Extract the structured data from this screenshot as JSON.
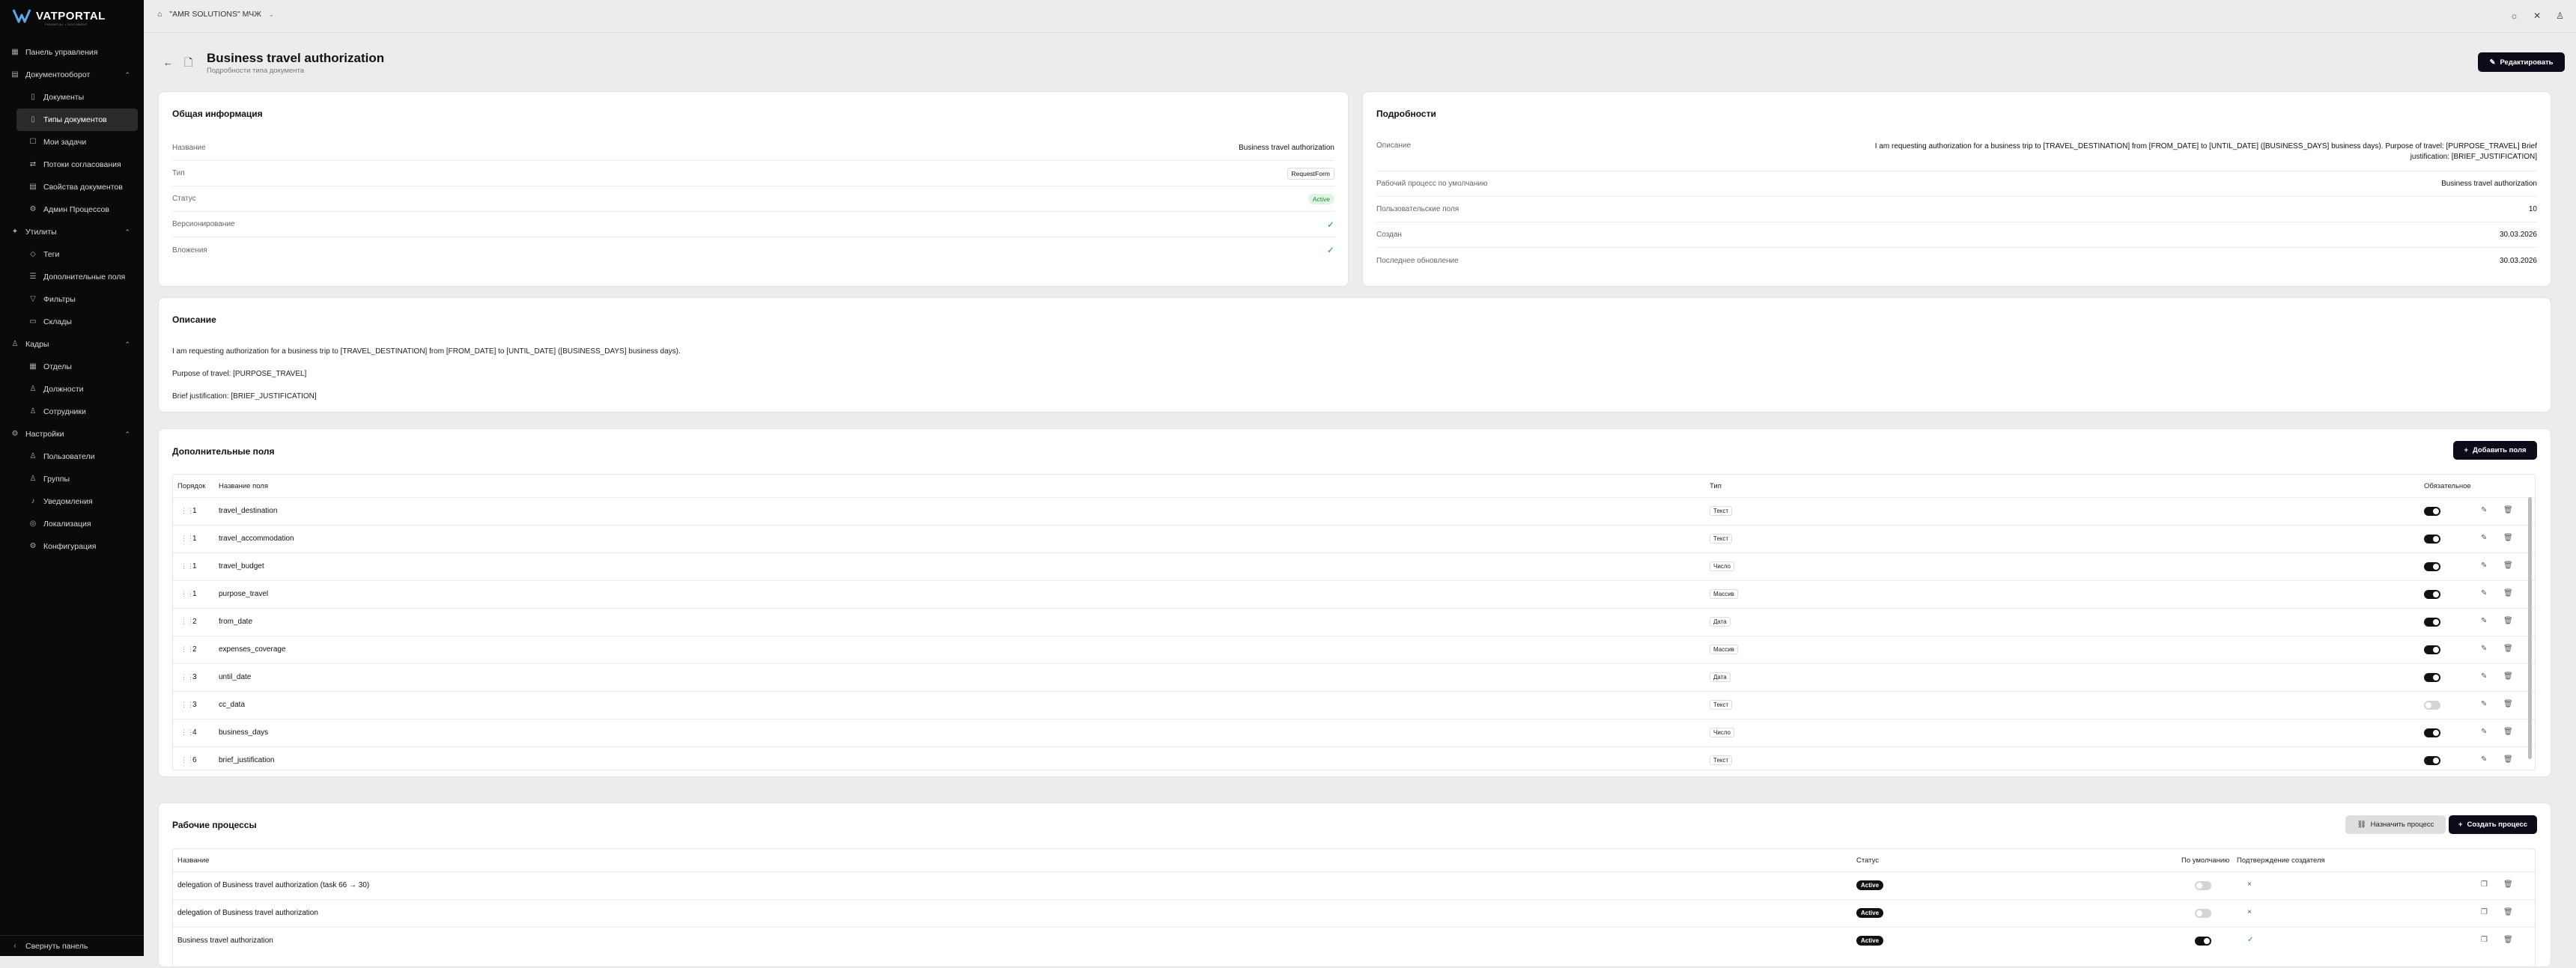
{
  "brand": {
    "name": "VATPORTAL",
    "tagline": "FINANCIAL • DOCUMENT"
  },
  "topbar": {
    "org": "\"AMR SOLUTIONS\" МЧЖ"
  },
  "sidebar": {
    "items": [
      {
        "label": "Панель управления",
        "icon": "grid-icon",
        "level": "top"
      },
      {
        "label": "Документооборот",
        "icon": "doc-icon",
        "level": "top",
        "expanded": true
      },
      {
        "label": "Документы",
        "icon": "file-icon",
        "level": "sub"
      },
      {
        "label": "Типы документов",
        "icon": "file-type-icon",
        "level": "sub",
        "active": true
      },
      {
        "label": "Мои задачи",
        "icon": "task-icon",
        "level": "sub"
      },
      {
        "label": "Потоки согласования",
        "icon": "flow-icon",
        "level": "sub"
      },
      {
        "label": "Свойства документов",
        "icon": "props-icon",
        "level": "sub"
      },
      {
        "label": "Админ Процессов",
        "icon": "admin-icon",
        "level": "sub"
      },
      {
        "label": "Утилиты",
        "icon": "tools-icon",
        "level": "top",
        "expanded": true
      },
      {
        "label": "Теги",
        "icon": "tag-icon",
        "level": "sub"
      },
      {
        "label": "Дополнительные поля",
        "icon": "fields-icon",
        "level": "sub"
      },
      {
        "label": "Фильтры",
        "icon": "filter-icon",
        "level": "sub"
      },
      {
        "label": "Склады",
        "icon": "warehouse-icon",
        "level": "sub"
      },
      {
        "label": "Кадры",
        "icon": "people-icon",
        "level": "top",
        "expanded": true
      },
      {
        "label": "Отделы",
        "icon": "dept-icon",
        "level": "sub"
      },
      {
        "label": "Должности",
        "icon": "position-icon",
        "level": "sub"
      },
      {
        "label": "Сотрудники",
        "icon": "staff-icon",
        "level": "sub"
      },
      {
        "label": "Настройки",
        "icon": "settings-icon",
        "level": "top",
        "expanded": true
      },
      {
        "label": "Пользователи",
        "icon": "users-icon",
        "level": "sub"
      },
      {
        "label": "Группы",
        "icon": "groups-icon",
        "level": "sub"
      },
      {
        "label": "Уведомления",
        "icon": "bell-icon",
        "level": "sub"
      },
      {
        "label": "Локализация",
        "icon": "locale-icon",
        "level": "sub"
      },
      {
        "label": "Конфигурация",
        "icon": "config-icon",
        "level": "sub"
      }
    ],
    "collapse_label": "Свернуть панель"
  },
  "header": {
    "title": "Business travel authorization",
    "subtitle": "Подробности типа документа",
    "edit_label": "Редактировать"
  },
  "general": {
    "title": "Общая информация",
    "rows": [
      {
        "key": "Название",
        "value": "Business travel authorization"
      },
      {
        "key": "Тип",
        "value": "RequestForm"
      },
      {
        "key": "Статус",
        "value": "Active"
      },
      {
        "key": "Версионирование",
        "value": ""
      },
      {
        "key": "Вложения",
        "value": ""
      }
    ]
  },
  "details": {
    "title": "Подробности",
    "rows": [
      {
        "key": "Описание",
        "value_line1": "I am requesting authorization for a business trip to [TRAVEL_DESTINATION] from [FROM_DATE] to [UNTIL_DATE] ([BUSINESS_DAYS] business days). Purpose of travel: [PURPOSE_TRAVEL] Brief",
        "value_line2": "justification: [BRIEF_JUSTIFICATION]"
      },
      {
        "key": "Рабочий процесс по умолчанию",
        "value": "Business travel authorization"
      },
      {
        "key": "Пользовательские поля",
        "value": "10"
      },
      {
        "key": "Создан",
        "value": "30.03.2026"
      },
      {
        "key": "Последнее обновление",
        "value": "30.03.2026"
      }
    ]
  },
  "description": {
    "title": "Описание",
    "lines": [
      "I am requesting authorization for a business trip to [TRAVEL_DESTINATION] from [FROM_DATE] to [UNTIL_DATE] ([BUSINESS_DAYS] business days).",
      "Purpose of travel: [PURPOSE_TRAVEL]",
      "Brief justification: [BRIEF_JUSTIFICATION]"
    ]
  },
  "fields": {
    "title": "Дополнительные поля",
    "add_label": "Добавить поля",
    "headers": {
      "order": "Порядок",
      "name": "Название поля",
      "type": "Тип",
      "required": "Обязательное"
    },
    "rows": [
      {
        "order": "1",
        "name": "travel_destination",
        "type": "Текст",
        "required": true
      },
      {
        "order": "1",
        "name": "travel_accommodation",
        "type": "Текст",
        "required": true
      },
      {
        "order": "1",
        "name": "travel_budget",
        "type": "Число",
        "required": true
      },
      {
        "order": "1",
        "name": "purpose_travel",
        "type": "Массив",
        "required": true
      },
      {
        "order": "2",
        "name": "from_date",
        "type": "Дата",
        "required": true
      },
      {
        "order": "2",
        "name": "expenses_coverage",
        "type": "Массив",
        "required": true
      },
      {
        "order": "3",
        "name": "until_date",
        "type": "Дата",
        "required": true
      },
      {
        "order": "3",
        "name": "cc_data",
        "type": "Текст",
        "required": false
      },
      {
        "order": "4",
        "name": "business_days",
        "type": "Число",
        "required": true
      },
      {
        "order": "6",
        "name": "brief_justification",
        "type": "Текст",
        "required": true
      }
    ]
  },
  "workflows": {
    "title": "Рабочие процессы",
    "assign_label": "Назначить процесс",
    "create_label": "Создать процесс",
    "headers": {
      "name": "Название",
      "status": "Статус",
      "default": "По умолчанию",
      "creator": "Подтверждение создателя"
    },
    "rows": [
      {
        "name": "delegation of Business travel authorization (task 66 → 30)",
        "status": "Active",
        "default": false,
        "creator": false
      },
      {
        "name": "delegation of Business travel authorization",
        "status": "Active",
        "default": false,
        "creator": false
      },
      {
        "name": "Business travel authorization",
        "status": "Active",
        "default": true,
        "creator": true
      }
    ]
  }
}
